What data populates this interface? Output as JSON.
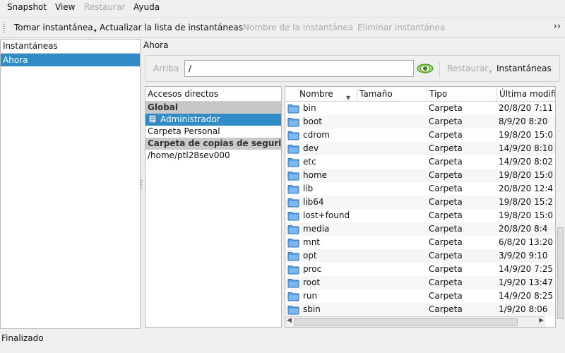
{
  "menu": {
    "items": [
      {
        "label": "Snapshot",
        "enabled": true
      },
      {
        "label": "View",
        "enabled": true
      },
      {
        "label": "Restaurar",
        "enabled": false
      },
      {
        "label": "Ayuda",
        "enabled": true
      }
    ]
  },
  "toolbar": {
    "take_snapshot": "Tomar instantánea",
    "refresh": "Actualizar la lista de instantáneas",
    "snapshot_name": "Nombre de la instantánea",
    "delete_snapshot": "Eliminar instantánea",
    "more": "››"
  },
  "snapshots_panel": {
    "header": "Instantáneas",
    "items": [
      "Ahora"
    ]
  },
  "main": {
    "title": "Ahora",
    "up_label": "Arriba",
    "path_value": "/",
    "restore_label": "Restaurar",
    "snapshots_label": "Instantáneas"
  },
  "shortcuts": {
    "header": "Accesos directos",
    "group_global": "Global",
    "admin": "Administrador",
    "home": "Carpeta Personal",
    "group_backup": "Carpeta de copias de seguridad",
    "backup_path": "/home/ptl28sev000"
  },
  "files": {
    "columns": [
      "Nombre",
      "Tamaño",
      "Tipo",
      "Última modificación"
    ],
    "rows": [
      {
        "name": "bin",
        "size": "",
        "type": "Carpeta",
        "modified": "20/8/20 7:11"
      },
      {
        "name": "boot",
        "size": "",
        "type": "Carpeta",
        "modified": "8/9/20 8:20"
      },
      {
        "name": "cdrom",
        "size": "",
        "type": "Carpeta",
        "modified": "19/8/20 15:0"
      },
      {
        "name": "dev",
        "size": "",
        "type": "Carpeta",
        "modified": "14/9/20 8:10"
      },
      {
        "name": "etc",
        "size": "",
        "type": "Carpeta",
        "modified": "14/9/20 8:02"
      },
      {
        "name": "home",
        "size": "",
        "type": "Carpeta",
        "modified": "19/8/20 15:0"
      },
      {
        "name": "lib",
        "size": "",
        "type": "Carpeta",
        "modified": "20/8/20 12:4"
      },
      {
        "name": "lib64",
        "size": "",
        "type": "Carpeta",
        "modified": "19/8/20 15:2"
      },
      {
        "name": "lost+found",
        "size": "",
        "type": "Carpeta",
        "modified": "19/8/20 15:0"
      },
      {
        "name": "media",
        "size": "",
        "type": "Carpeta",
        "modified": "20/8/20 8:4"
      },
      {
        "name": "mnt",
        "size": "",
        "type": "Carpeta",
        "modified": "6/8/20 13:20"
      },
      {
        "name": "opt",
        "size": "",
        "type": "Carpeta",
        "modified": "3/9/20 9:10"
      },
      {
        "name": "proc",
        "size": "",
        "type": "Carpeta",
        "modified": "14/9/20 7:25"
      },
      {
        "name": "root",
        "size": "",
        "type": "Carpeta",
        "modified": "1/9/20 13:47"
      },
      {
        "name": "run",
        "size": "",
        "type": "Carpeta",
        "modified": "14/9/20 8:25"
      },
      {
        "name": "sbin",
        "size": "",
        "type": "Carpeta",
        "modified": "1/9/20 8:06"
      }
    ]
  },
  "status": {
    "text": "Finalizado"
  },
  "colors": {
    "selection": "#308cc6",
    "folder": "#3d8ee0",
    "eye": "#6fbf2f"
  }
}
